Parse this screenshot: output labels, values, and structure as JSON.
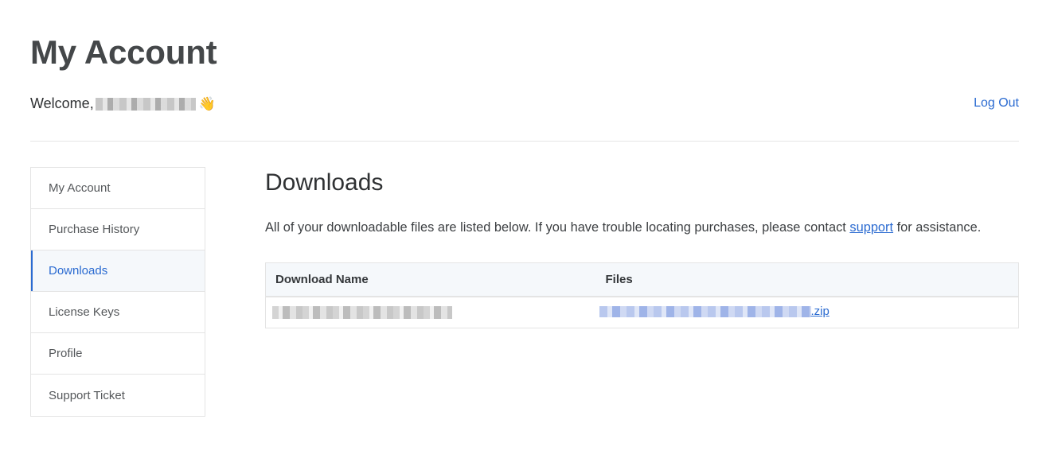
{
  "header": {
    "title": "My Account",
    "welcome_prefix": "Welcome,",
    "wave_emoji": "👋",
    "logout_label": "Log Out"
  },
  "sidebar": {
    "items": [
      {
        "label": "My Account"
      },
      {
        "label": "Purchase History"
      },
      {
        "label": "Downloads",
        "active": true
      },
      {
        "label": "License Keys"
      },
      {
        "label": "Profile"
      },
      {
        "label": "Support Ticket"
      }
    ]
  },
  "main": {
    "title": "Downloads",
    "description_before": "All of your downloadable files are listed below. If you have trouble locating purchases, please contact ",
    "description_link": "support",
    "description_after": " for assistance.",
    "table": {
      "headers": [
        "Download Name",
        "Files"
      ],
      "rows": [
        {
          "file_suffix": ".zip"
        }
      ]
    }
  },
  "colors": {
    "accent": "#2b6bd1",
    "border": "#e4e4e4",
    "header_bg": "#f5f8fb"
  }
}
